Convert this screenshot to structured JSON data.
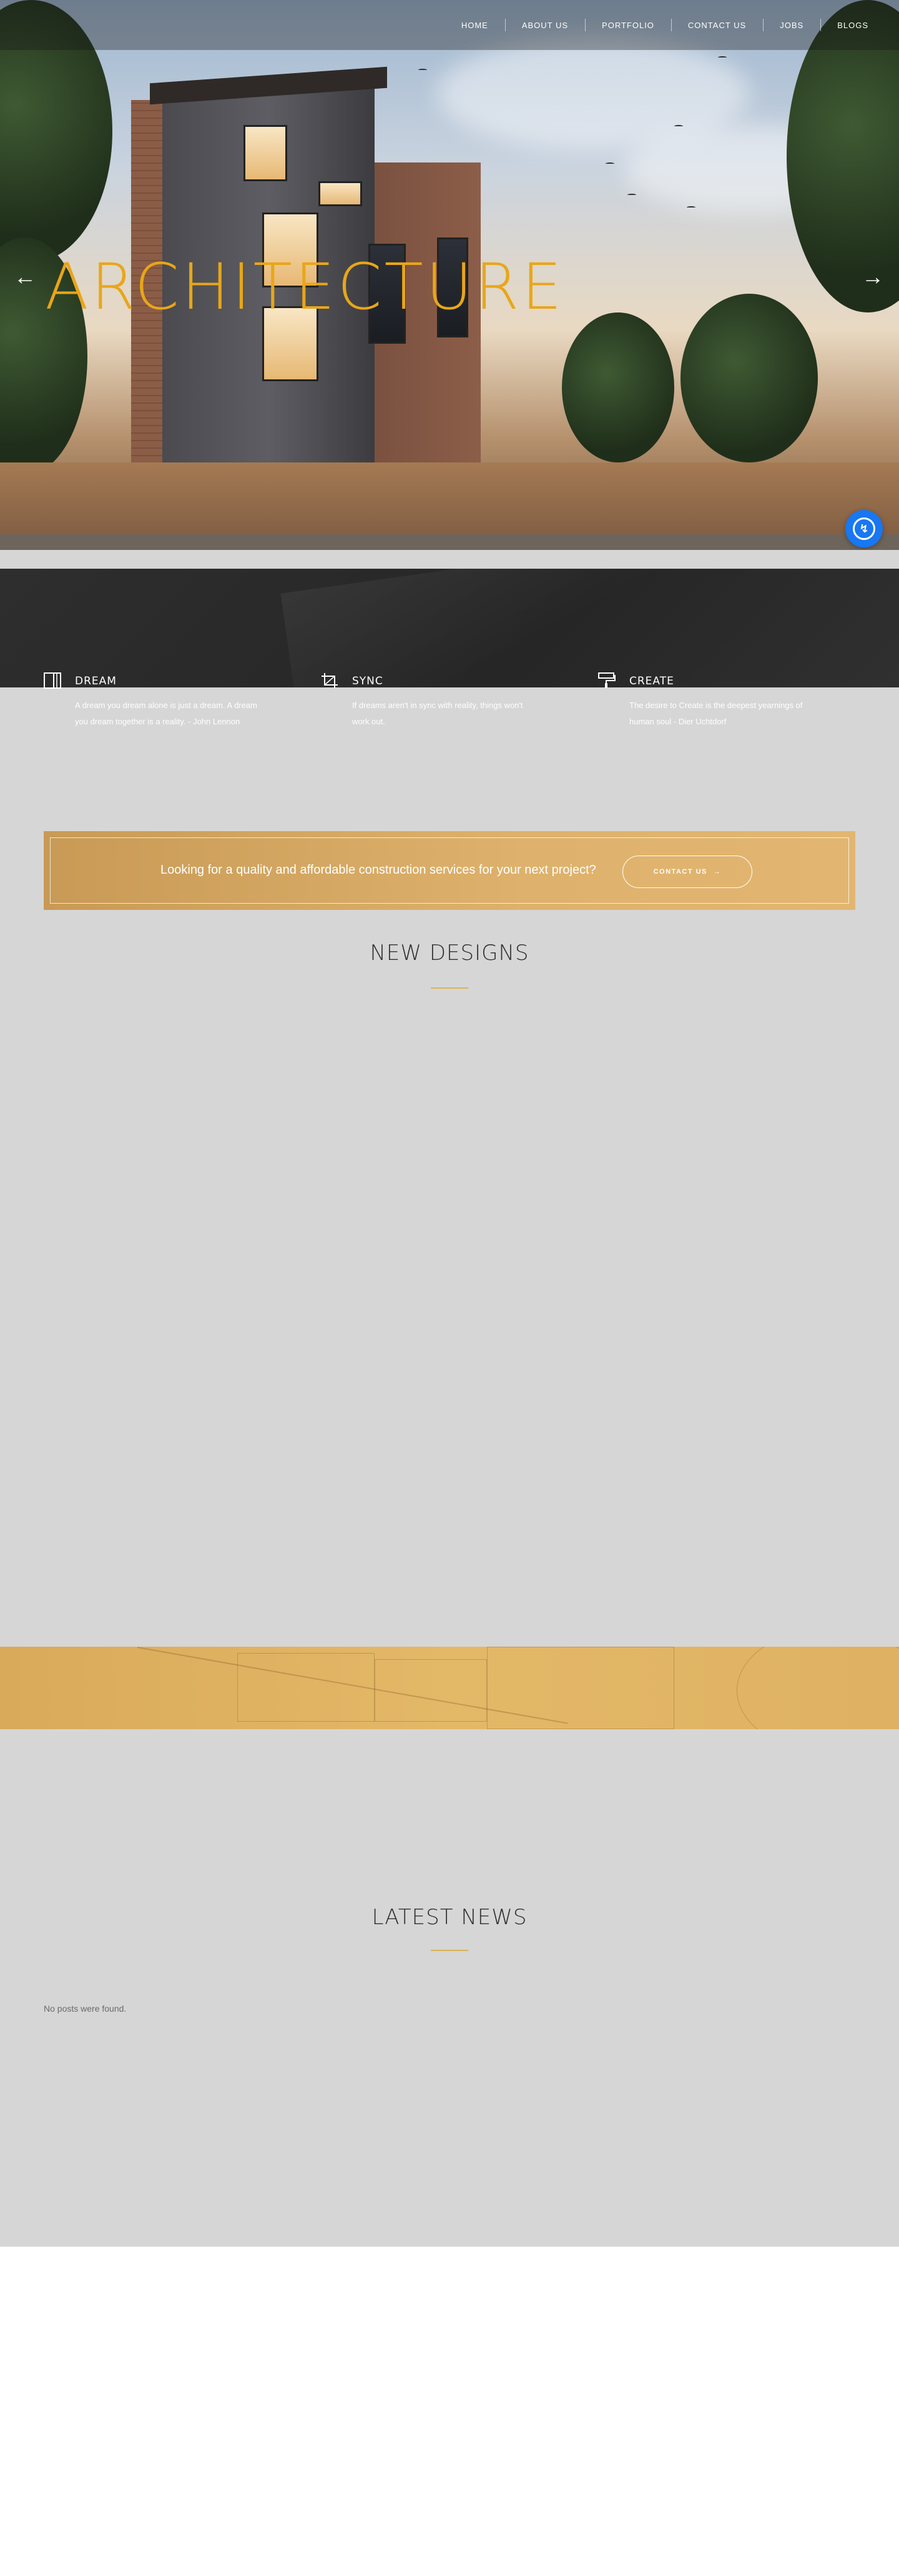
{
  "nav": {
    "items": [
      {
        "label": "HOME"
      },
      {
        "label": "ABOUT US"
      },
      {
        "label": "PORTFOLIO"
      },
      {
        "label": "CONTACT US"
      },
      {
        "label": "JOBS"
      },
      {
        "label": "BLOGS"
      }
    ]
  },
  "hero": {
    "title": "ARCHITECTURE",
    "prev_icon": "arrow-left-icon",
    "next_icon": "arrow-right-icon",
    "title_color": "#e8a619"
  },
  "messenger": {
    "icon": "messenger-icon",
    "color": "#1877f2"
  },
  "features": [
    {
      "icon": "door-icon",
      "title": "DREAM",
      "text": "A dream you dream alone is just a dream. A dream you dream together is a reality. - John Lennon"
    },
    {
      "icon": "crop-icon",
      "title": "SYNC",
      "text": "If dreams aren't in sync with reality, things won't work out."
    },
    {
      "icon": "paint-roller-icon",
      "title": "CREATE",
      "text": "The desire to Create is the deepest yearnings of human soul - Dier Uchtdorf"
    }
  ],
  "cta": {
    "text": "Looking for a quality and affordable construction services for your next project?",
    "button_label": "CONTACT US",
    "button_icon": "arrow-right-icon"
  },
  "sections": {
    "new_designs_title": "NEW DESIGNS",
    "latest_news_title": "LATEST NEWS",
    "no_posts": "No posts were found."
  },
  "colors": {
    "accent_gold": "#d8b35a",
    "dark_band": "#2b2b2b",
    "page_gray": "#d6d6d6"
  }
}
